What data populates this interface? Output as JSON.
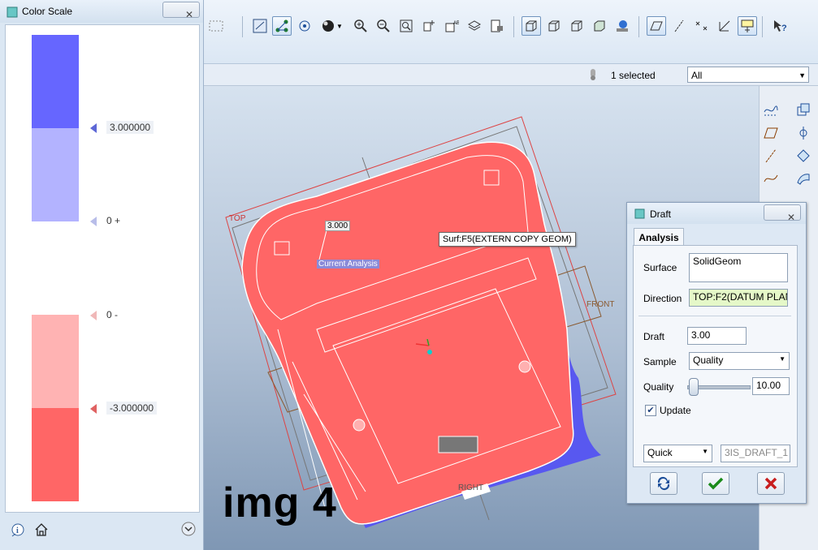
{
  "color_scale": {
    "title": "Color Scale",
    "close": "✕",
    "ticks": [
      "3.000000",
      "0 +",
      "0 -",
      "-3.000000"
    ],
    "colors": [
      "#6666ff",
      "#b3b3ff",
      "#ffffff",
      "#ffb3b3",
      "#ff6666"
    ]
  },
  "selection": {
    "count_label": "1 selected",
    "filter_value": "All"
  },
  "viewport": {
    "datum_top": "TOP",
    "datum_front": "FRONT",
    "datum_right": "RIGHT",
    "value_label": "3.000",
    "analysis_label": "Current Analysis",
    "tooltip": "Surf:F5(EXTERN COPY GEOM)",
    "overlay_text": "img 4"
  },
  "draft_dialog": {
    "title": "Draft",
    "close": "✕",
    "tab": "Analysis",
    "surface_label": "Surface",
    "surface_value": "SolidGeom",
    "direction_label": "Direction",
    "direction_value": "TOP:F2(DATUM PLAN",
    "draft_label": "Draft",
    "draft_value": "3.00",
    "sample_label": "Sample",
    "sample_value": "Quality",
    "quality_label": "Quality",
    "quality_value": "10.00",
    "update_label": "Update",
    "mode_value": "Quick",
    "name_value": "3IS_DRAFT_1"
  }
}
